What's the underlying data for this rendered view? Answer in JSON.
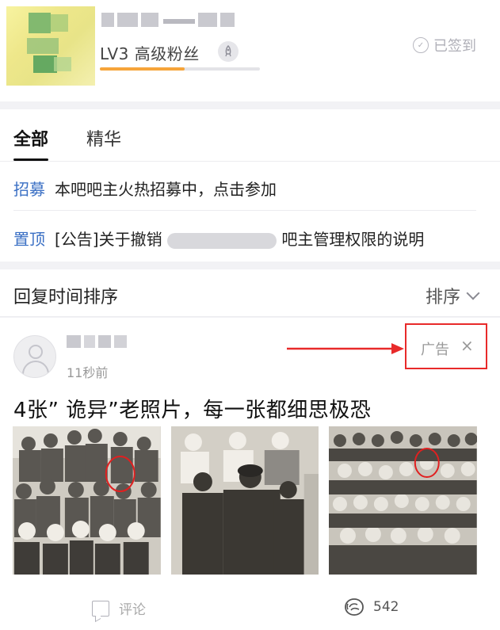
{
  "header": {
    "level_text": "LV3 高级粉丝",
    "level_progress": 0.53,
    "checked_in_label": "已签到",
    "rocket_icon": "rocket-icon",
    "sign_icon": "sign-in-icon"
  },
  "tabs": [
    {
      "label": "全部",
      "active": true
    },
    {
      "label": "精华",
      "active": false
    }
  ],
  "pinned": [
    {
      "tag": "招募",
      "text": "本吧吧主火热招募中，点击参加"
    },
    {
      "tag": "置顶",
      "text_before": "[公告]关于撤销",
      "text_after": "吧主管理权限的说明"
    }
  ],
  "sort": {
    "title": "回复时间排序",
    "button_label": "排序"
  },
  "post": {
    "time": "11秒前",
    "ad_label": "广告",
    "close_glyph": "×",
    "title": "4张” 诡异”老照片，每一张都细思极恐",
    "comment_label": "评论",
    "share_count": "542"
  },
  "colors": {
    "accent_blue": "#3a6fc4",
    "progress_orange": "#f6a43a",
    "annotation_red": "#e82a2a"
  }
}
